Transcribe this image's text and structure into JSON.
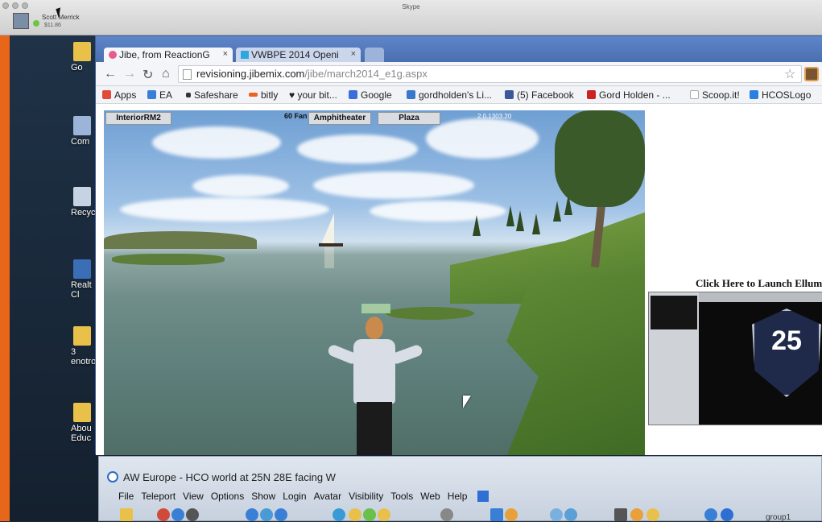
{
  "skype": {
    "title": "Skype",
    "user_name": "Scott Merrick",
    "credit": "$11.86"
  },
  "desktop": {
    "icons": [
      {
        "label": "Go"
      },
      {
        "label": "Com"
      },
      {
        "label": "Recyc"
      },
      {
        "label": "Realt Cl"
      },
      {
        "label": "3 enotro"
      },
      {
        "label": "Abou Educ"
      }
    ]
  },
  "browser": {
    "tabs": [
      {
        "label": "Jibe, from ReactionG",
        "close": "×"
      },
      {
        "label": "VWBPE 2014 Openi",
        "close": "×"
      }
    ],
    "url_host": "revisioning.jibemix.com",
    "url_path": "/jibe/march2014_e1g.aspx",
    "bookmarks": [
      {
        "label": "Apps",
        "icon": "apps-icon",
        "color": "#e04a3a"
      },
      {
        "label": "EA",
        "icon": "ea-icon",
        "color": "#3a7fd6"
      },
      {
        "label": "Safeshare",
        "icon": "safeshare-icon",
        "color": "#333333"
      },
      {
        "label": "bitly",
        "icon": "bitly-icon",
        "color": "#ee6123"
      },
      {
        "label": "♥ your bit...",
        "icon": "heart-icon",
        "color": "#222222"
      },
      {
        "label": "Google",
        "icon": "google-icon",
        "color": "#3a6fd8"
      },
      {
        "label": "gordholden's Li...",
        "icon": "delicious-icon",
        "color": "#3a78c9"
      },
      {
        "label": "(5) Facebook",
        "icon": "facebook-icon",
        "color": "#3b5998"
      },
      {
        "label": "Gord Holden - ...",
        "icon": "youtube-icon",
        "color": "#cc2222"
      },
      {
        "label": "Scoop.it!",
        "icon": "page-icon",
        "color": "#dddddd"
      },
      {
        "label": "HCOSLogo",
        "icon": "dropbox-icon",
        "color": "#2b7fe0"
      }
    ]
  },
  "jibe": {
    "buttons": {
      "interior": "InteriorRM2",
      "amphitheater": "Amphitheater",
      "plaza": "Plaza"
    },
    "fps": "60 Fan",
    "version": "2.0.1303.20"
  },
  "ellum": {
    "heading": "Click Here to Launch Ellum",
    "badge_number": "25"
  },
  "aw": {
    "title": "AW Europe - HCO world at 25N 28E facing W",
    "menu": [
      "File",
      "Teleport",
      "View",
      "Options",
      "Show",
      "Login",
      "Avatar",
      "Visibility",
      "Tools",
      "Web",
      "Help"
    ],
    "group_label": "group1"
  }
}
